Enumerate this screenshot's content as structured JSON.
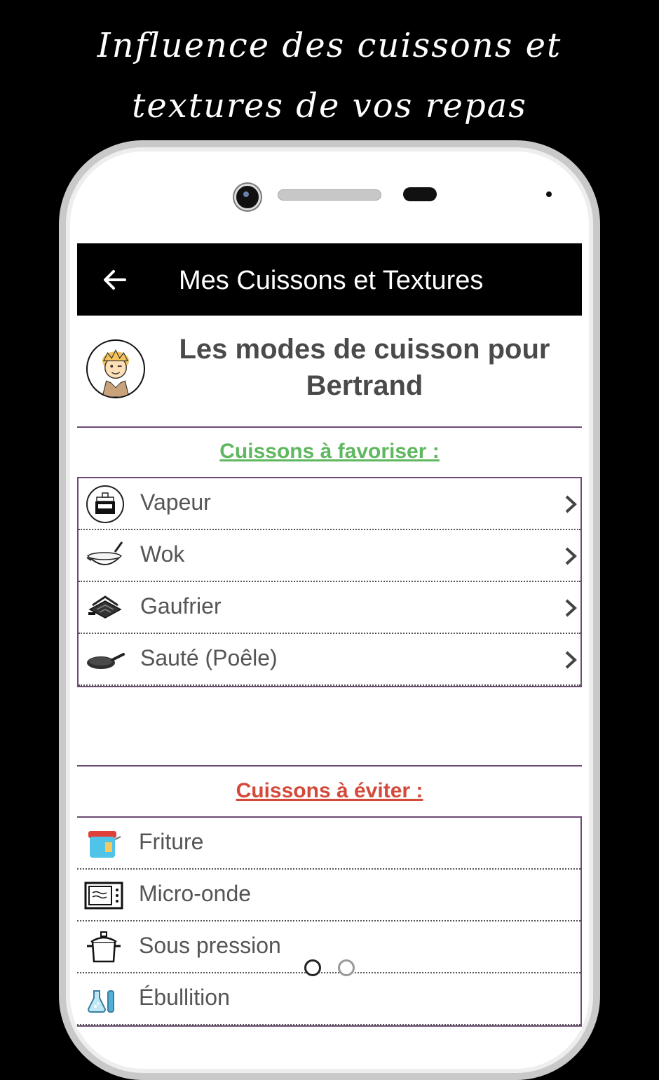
{
  "promo": {
    "line1": "Influence des cuissons et",
    "line2": "textures de vos repas"
  },
  "appbar": {
    "back_icon": "arrow-left-icon",
    "title": "Mes Cuissons et Textures"
  },
  "profile": {
    "avatar_icon": "chef-avatar-icon",
    "title": "Les modes de cuisson pour Bertrand"
  },
  "favor": {
    "heading": "Cuissons à favoriser :",
    "color": "#5fb85f",
    "items": [
      {
        "label": "Vapeur",
        "icon": "steamer-icon"
      },
      {
        "label": "Wok",
        "icon": "wok-icon"
      },
      {
        "label": "Gaufrier",
        "icon": "waffle-iron-icon"
      },
      {
        "label": "Sauté (Poêle)",
        "icon": "frying-pan-icon"
      }
    ]
  },
  "avoid": {
    "heading": "Cuissons à éviter :",
    "color": "#d34a3a",
    "items": [
      {
        "label": "Friture",
        "icon": "fryer-icon"
      },
      {
        "label": "Micro-onde",
        "icon": "microwave-icon"
      },
      {
        "label": "Sous pression",
        "icon": "pressure-cooker-icon"
      },
      {
        "label": "Ébullition",
        "icon": "boiling-icon"
      }
    ]
  },
  "pager": {
    "active_page": 1,
    "page_count": 2
  },
  "colors": {
    "accent_border": "#6d4a73",
    "appbar": "#000000"
  }
}
